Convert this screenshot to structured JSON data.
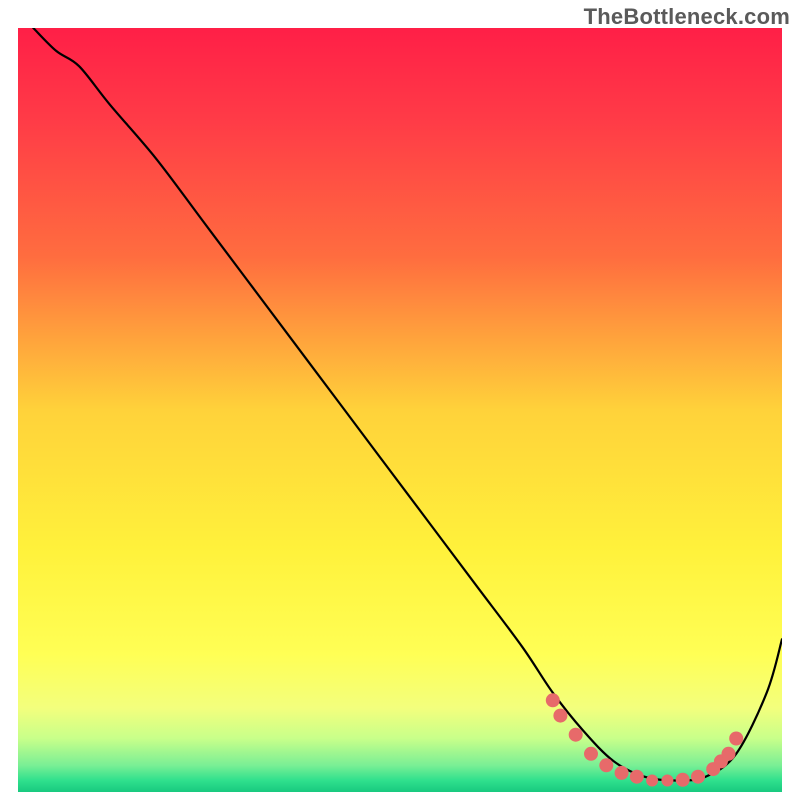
{
  "watermark": "TheBottleneck.com",
  "chart_data": {
    "type": "line",
    "title": "",
    "xlabel": "",
    "ylabel": "",
    "xlim": [
      0,
      100
    ],
    "ylim": [
      0,
      100
    ],
    "background_gradient": {
      "stops": [
        {
          "offset": 0.0,
          "color": "#ff1f47"
        },
        {
          "offset": 0.12,
          "color": "#ff3b47"
        },
        {
          "offset": 0.3,
          "color": "#ff6d3f"
        },
        {
          "offset": 0.5,
          "color": "#ffd23a"
        },
        {
          "offset": 0.68,
          "color": "#fff13b"
        },
        {
          "offset": 0.82,
          "color": "#ffff55"
        },
        {
          "offset": 0.89,
          "color": "#f3ff7d"
        },
        {
          "offset": 0.93,
          "color": "#c8ff8a"
        },
        {
          "offset": 0.965,
          "color": "#7aef95"
        },
        {
          "offset": 0.985,
          "color": "#2fe08d"
        },
        {
          "offset": 1.0,
          "color": "#18c97f"
        }
      ]
    },
    "series": [
      {
        "name": "bottleneck-curve",
        "color": "#000000",
        "x": [
          2,
          5,
          8,
          12,
          18,
          24,
          30,
          36,
          42,
          48,
          54,
          60,
          66,
          70,
          74,
          78,
          82,
          86,
          90,
          94,
          98,
          100
        ],
        "y": [
          100,
          97,
          95,
          90,
          83,
          75,
          67,
          59,
          51,
          43,
          35,
          27,
          19,
          13,
          8,
          4,
          2,
          1.5,
          2,
          5,
          13,
          20
        ]
      }
    ],
    "markers": {
      "name": "highlight-dots",
      "color": "#e76a6a",
      "points": [
        {
          "x": 70,
          "y": 12
        },
        {
          "x": 71,
          "y": 10
        },
        {
          "x": 73,
          "y": 7.5
        },
        {
          "x": 75,
          "y": 5
        },
        {
          "x": 77,
          "y": 3.5
        },
        {
          "x": 79,
          "y": 2.5
        },
        {
          "x": 81,
          "y": 2
        },
        {
          "x": 83,
          "y": 1.5,
          "r": 6
        },
        {
          "x": 85,
          "y": 1.5,
          "r": 6
        },
        {
          "x": 87,
          "y": 1.6
        },
        {
          "x": 89,
          "y": 2
        },
        {
          "x": 91,
          "y": 3
        },
        {
          "x": 92,
          "y": 4
        },
        {
          "x": 93,
          "y": 5
        },
        {
          "x": 94,
          "y": 7
        }
      ],
      "default_r": 7
    }
  }
}
